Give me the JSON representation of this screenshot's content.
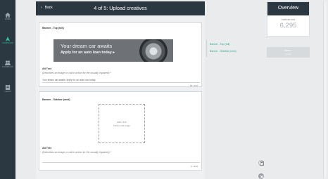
{
  "nav": {
    "items": [
      {
        "label": "HOME",
        "icon": "home-icon"
      },
      {
        "label": "CAMPAIGNS",
        "icon": "campaigns-icon"
      },
      {
        "label": "AUDIENCES",
        "icon": "audiences-icon"
      },
      {
        "label": "LEARN",
        "icon": "learn-icon"
      }
    ],
    "active_color": "#35c3a0"
  },
  "header": {
    "back_label": "Back",
    "title": "4 of 5: Upload creatives"
  },
  "cards": [
    {
      "title": "Banner - Top (full)",
      "banner_line1": "Your dream car awaits",
      "banner_line2": "Apply for an auto loan today ▸",
      "alt_label": "Alt Text",
      "alt_placeholder": "(Describes an image or call to action for the visually impaired)",
      "alt_value": "Your dream car awaits. Apply for an auto loan today.",
      "counter": "53 / 100"
    },
    {
      "title": "Banner - Sidebar (med)",
      "drop_dims": "326 × 270",
      "drop_hint": "Click to add image",
      "alt_label": "Alt Text",
      "alt_placeholder": "(Describes an image or call to action for the visually impaired)",
      "counter": "0 / 100"
    }
  ],
  "side_list": [
    "Banner - Top (full)",
    "Banner - Sidebar (med)"
  ],
  "overview": {
    "title": "Overview",
    "audience_label": "Audience size",
    "audience_value": "6,295"
  },
  "next_button": {
    "label": "Next",
    "sub": "Details"
  },
  "colors": {
    "header": "#2b3841",
    "accent": "#35c3a0",
    "link": "#2ea58a",
    "required": "#d9534f"
  }
}
